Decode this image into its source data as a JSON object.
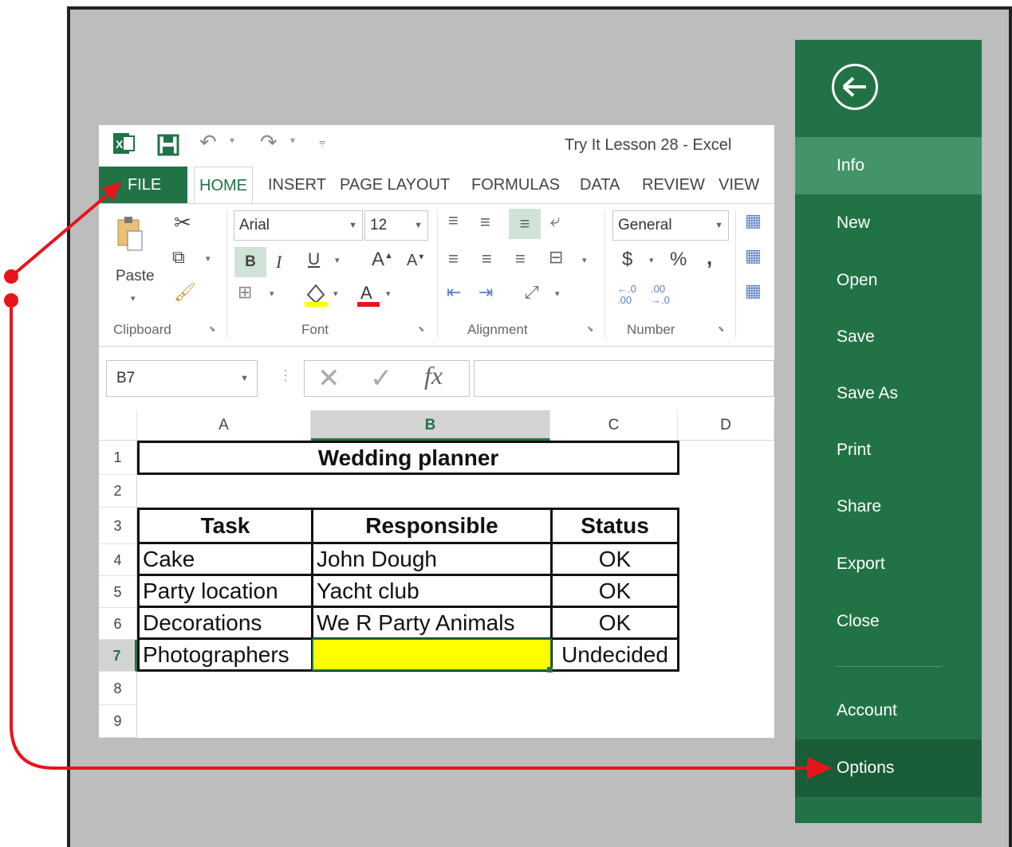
{
  "window": {
    "title": "Try It Lesson 28 - Excel"
  },
  "ribbon": {
    "tabs": [
      "FILE",
      "HOME",
      "INSERT",
      "PAGE LAYOUT",
      "FORMULAS",
      "DATA",
      "REVIEW",
      "VIEW"
    ],
    "active_tab": "HOME",
    "groups": [
      "Clipboard",
      "Font",
      "Alignment",
      "Number"
    ],
    "paste_label": "Paste",
    "font_name": "Arial",
    "font_size": "12",
    "number_format": "General"
  },
  "formula_bar": {
    "name_box": "B7",
    "fx": "fx",
    "formula": ""
  },
  "sheet": {
    "columns": [
      "A",
      "B",
      "C",
      "D"
    ],
    "rows": [
      "1",
      "2",
      "3",
      "4",
      "5",
      "6",
      "7",
      "8",
      "9"
    ],
    "title": "Wedding planner",
    "headers": [
      "Task",
      "Responsible",
      "Status"
    ],
    "data": [
      [
        "Cake",
        "John Dough",
        "OK"
      ],
      [
        "Party location",
        "Yacht club",
        "OK"
      ],
      [
        "Decorations",
        "We R Party Animals",
        "OK"
      ],
      [
        "Photographers",
        "",
        "Undecided"
      ]
    ],
    "highlight_color": "#ffff00",
    "selected_cell": "B7"
  },
  "backstage": {
    "items": [
      "Info",
      "New",
      "Open",
      "Save",
      "Save As",
      "Print",
      "Share",
      "Export",
      "Close",
      "Account",
      "Options"
    ],
    "bg_color": "#217346"
  },
  "annotation": {
    "arrow_color": "#e8141b"
  }
}
